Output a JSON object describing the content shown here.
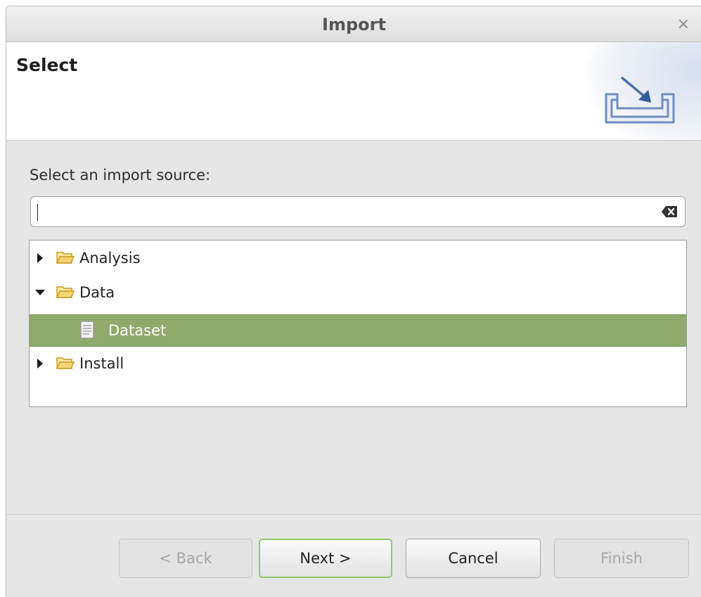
{
  "window": {
    "title": "Import",
    "close_glyph": "×"
  },
  "banner": {
    "title": "Select",
    "icon": "import-icon"
  },
  "source": {
    "label": "Select an import source:",
    "filter_value": "",
    "clear_icon": "clear-filter-icon"
  },
  "tree": {
    "items": [
      {
        "label": "Analysis",
        "type": "folder",
        "expanded": false,
        "selected": false
      },
      {
        "label": "Data",
        "type": "folder",
        "expanded": true,
        "selected": false
      },
      {
        "label": "Dataset",
        "type": "file",
        "selected": true
      },
      {
        "label": "Install",
        "type": "folder",
        "expanded": false,
        "selected": false
      }
    ],
    "selection_color": "#8faa6a"
  },
  "buttons": {
    "back": {
      "label": "< Back",
      "enabled": false
    },
    "next": {
      "label": "Next >",
      "enabled": true
    },
    "cancel": {
      "label": "Cancel",
      "enabled": true
    },
    "finish": {
      "label": "Finish",
      "enabled": false
    }
  }
}
